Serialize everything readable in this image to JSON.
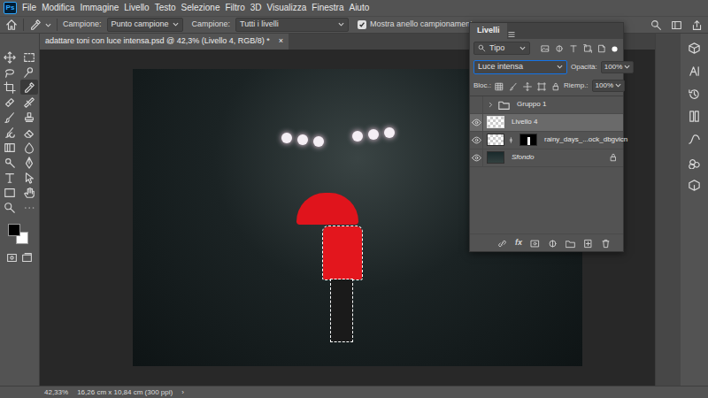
{
  "app": {
    "logo": "Ps"
  },
  "menu": [
    "File",
    "Modifica",
    "Immagine",
    "Livello",
    "Testo",
    "Selezione",
    "Filtro",
    "3D",
    "Visualizza",
    "Finestra",
    "Aiuto"
  ],
  "options_bar": {
    "sample_size_label": "Campione:",
    "sample_size": "Punto campione",
    "sample_label": "Campione:",
    "sample": "Tutti i livelli",
    "show_ring": {
      "label": "Mostra anello campionamento",
      "checked": true
    }
  },
  "document_tab": {
    "title": "adattare toni con luce intensa.psd @ 42,3% (Livello 4, RGB/8) *",
    "close": "×"
  },
  "tools": [
    {
      "selected": false
    },
    {
      "selected": false
    },
    {
      "selected": false
    },
    {
      "selected": false
    },
    {
      "selected": false
    },
    {
      "selected": true
    },
    {
      "selected": false
    },
    {
      "selected": false
    },
    {
      "selected": false
    },
    {
      "selected": false
    },
    {
      "selected": false
    },
    {
      "selected": false
    },
    {
      "selected": false
    },
    {
      "selected": false
    },
    {
      "selected": false
    },
    {
      "selected": false
    },
    {
      "selected": false
    },
    {
      "selected": false
    },
    {
      "selected": false
    },
    {
      "selected": false
    },
    {
      "selected": false
    },
    {
      "selected": false
    }
  ],
  "swatches": [
    {
      "name": "foreground",
      "color": "#000000"
    },
    {
      "name": "background",
      "color": "#ffffff"
    }
  ],
  "layers_panel": {
    "title": "Livelli",
    "filter": "Tipo",
    "blend_mode": "Luce intensa",
    "opacity_label": "Opacità:",
    "opacity": "100%",
    "lock_label": "Bloc.:",
    "fill_label": "Riemp.:",
    "fill": "100%",
    "fx": "fx",
    "layers": [
      {
        "name": "Gruppo 1",
        "kind": "group",
        "visible": false,
        "selected": false,
        "locked": false
      },
      {
        "name": "Livello 4",
        "kind": "pixel",
        "visible": true,
        "selected": true,
        "locked": false
      },
      {
        "name": "rainy_days_...ock_dbgvicn",
        "kind": "masked",
        "visible": true,
        "selected": false,
        "locked": false
      },
      {
        "name": "Sfondo",
        "kind": "background",
        "visible": true,
        "selected": false,
        "locked": true
      }
    ]
  },
  "status_bar": {
    "zoom": "42,33%",
    "doc_size": "16,26 cm x 10,84 cm (300 ppi)",
    "arrow": "›"
  }
}
